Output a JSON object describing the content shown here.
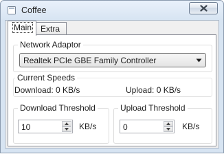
{
  "window": {
    "title": "Coffee",
    "close_icon": "close-x-icon",
    "app_icon": "coffee-app-icon"
  },
  "tabs": [
    {
      "label": "Main",
      "selected": true
    },
    {
      "label": "Extra",
      "selected": false
    }
  ],
  "network": {
    "group_label": "Network Adaptor",
    "selected_adapter": "Realtek PCIe GBE Family Controller"
  },
  "speeds": {
    "group_label": "Current Speeds",
    "download": "Download: 0 KB/s",
    "upload": "Upload: 0 KB/s"
  },
  "download_threshold": {
    "group_label": "Download Threshold",
    "value": "10",
    "unit": "KB/s"
  },
  "upload_threshold": {
    "group_label": "Upload Threshold",
    "value": "0",
    "unit": "KB/s"
  }
}
